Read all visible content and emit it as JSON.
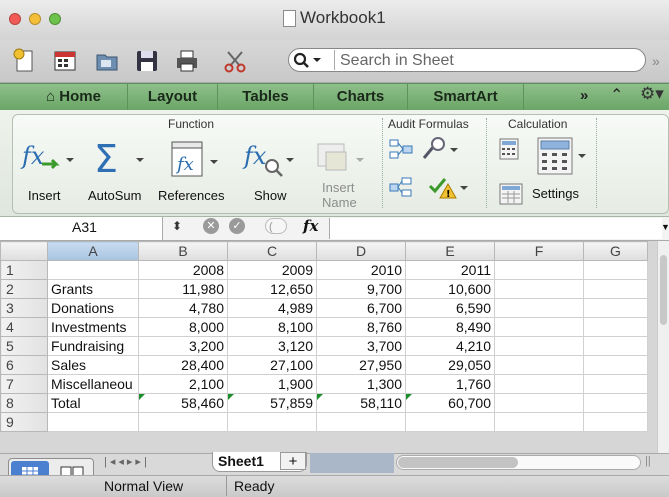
{
  "window": {
    "title": "Workbook1"
  },
  "search": {
    "placeholder": "Search in Sheet"
  },
  "ribbon_tabs": [
    "Home",
    "Layout",
    "Tables",
    "Charts",
    "SmartArt"
  ],
  "ribbon": {
    "groups": {
      "function": "Function",
      "audit": "Audit Formulas",
      "calculation": "Calculation"
    },
    "buttons": {
      "insert": "Insert",
      "autosum": "AutoSum",
      "references": "References",
      "show": "Show",
      "insert_name_line1": "Insert",
      "insert_name_line2": "Name",
      "settings": "Settings"
    }
  },
  "formula_bar": {
    "name_box": "A31",
    "fx": "fx",
    "value": ""
  },
  "sheet": {
    "columns": [
      "A",
      "B",
      "C",
      "D",
      "E",
      "F",
      "G"
    ],
    "rows": [
      {
        "n": "1",
        "a": "",
        "b": "2008",
        "c": "2009",
        "d": "2010",
        "e": "2011"
      },
      {
        "n": "2",
        "a": "Grants",
        "b": "11,980",
        "c": "12,650",
        "d": "9,700",
        "e": "10,600"
      },
      {
        "n": "3",
        "a": "Donations",
        "b": "4,780",
        "c": "4,989",
        "d": "6,700",
        "e": "6,590"
      },
      {
        "n": "4",
        "a": "Investments",
        "b": "8,000",
        "c": "8,100",
        "d": "8,760",
        "e": "8,490"
      },
      {
        "n": "5",
        "a": "Fundraising",
        "b": "3,200",
        "c": "3,120",
        "d": "3,700",
        "e": "4,210"
      },
      {
        "n": "6",
        "a": "Sales",
        "b": "28,400",
        "c": "27,100",
        "d": "27,950",
        "e": "29,050"
      },
      {
        "n": "7",
        "a": "Miscellaneou",
        "b": "2,100",
        "c": "1,900",
        "d": "1,300",
        "e": "1,760"
      },
      {
        "n": "8",
        "a": "Total",
        "b": "58,460",
        "c": "57,859",
        "d": "58,110",
        "e": "60,700"
      },
      {
        "n": "9",
        "a": "",
        "b": "",
        "c": "",
        "d": "",
        "e": ""
      }
    ]
  },
  "sheet_tabs": {
    "active": "Sheet1",
    "add": "+"
  },
  "status": {
    "view": "Normal View",
    "state": "Ready"
  },
  "colors": {
    "ribbon_tab_green": "#7cb478",
    "formula_marker_green": "#1b8d2b"
  }
}
